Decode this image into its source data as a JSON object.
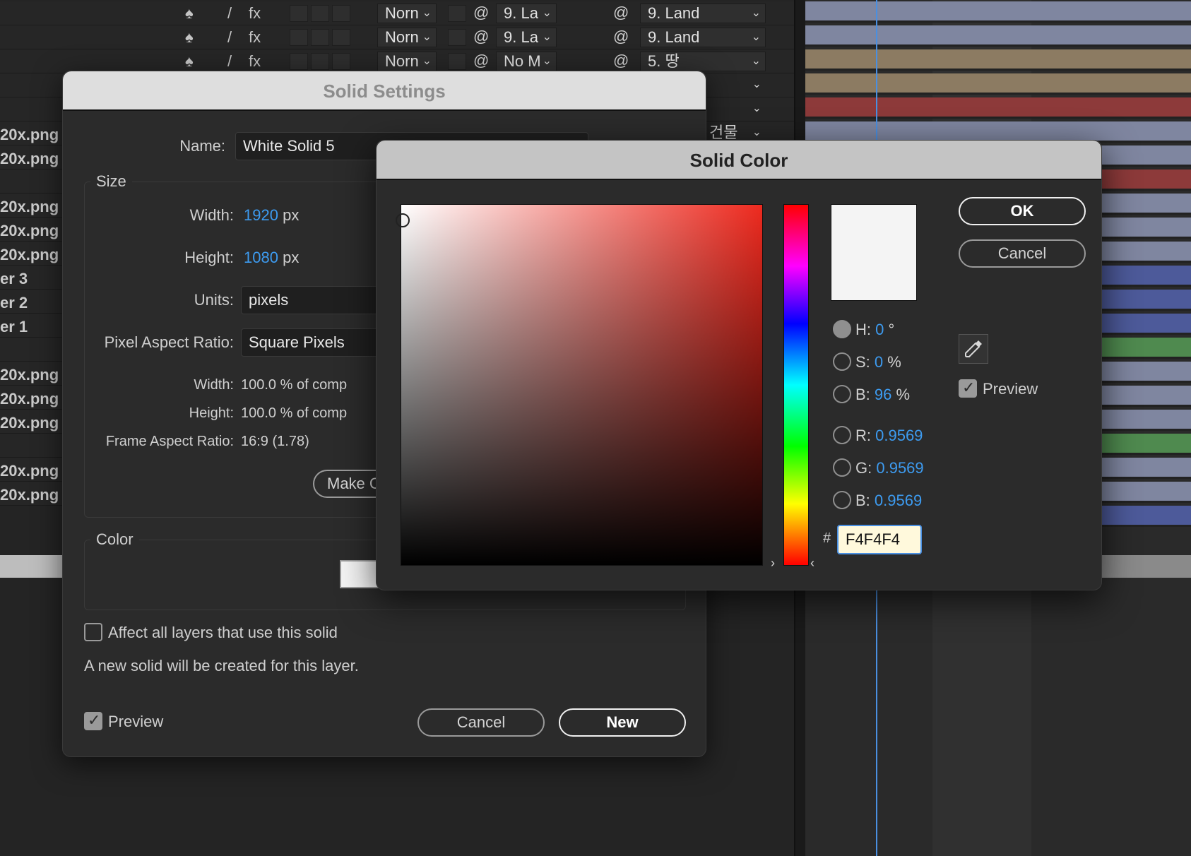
{
  "timeline": {
    "rows": [
      {
        "name": "",
        "mode": "Norn",
        "track_matte_src": "9. La",
        "parent": "9. Land"
      },
      {
        "name": "",
        "mode": "Norn",
        "track_matte_src": "9. La",
        "parent": "9. Land"
      },
      {
        "name": "",
        "mode": "Norn",
        "track_matte_src": "No M",
        "parent": "5. 땅"
      },
      {
        "name": "",
        "mode": "",
        "track_matte_src": "",
        "parent": ""
      },
      {
        "name": "",
        "mode": "",
        "track_matte_src": "",
        "parent": ""
      },
      {
        "name": "20x.png",
        "mode": "",
        "track_matte_src": "",
        "parent": "건물"
      },
      {
        "name": "20x.png",
        "mode": "",
        "track_matte_src": "",
        "parent": ""
      },
      {
        "name": "",
        "mode": "",
        "track_matte_src": "",
        "parent": ""
      },
      {
        "name": "20x.png",
        "mode": "",
        "track_matte_src": "",
        "parent": ""
      },
      {
        "name": "20x.png",
        "mode": "",
        "track_matte_src": "",
        "parent": ""
      },
      {
        "name": "20x.png",
        "mode": "",
        "track_matte_src": "",
        "parent": ""
      },
      {
        "name": "er 3",
        "mode": "",
        "track_matte_src": "",
        "parent": ""
      },
      {
        "name": "er 2",
        "mode": "",
        "track_matte_src": "",
        "parent": ""
      },
      {
        "name": "er 1",
        "mode": "",
        "track_matte_src": "",
        "parent": ""
      },
      {
        "name": "",
        "mode": "",
        "track_matte_src": "",
        "parent": ""
      },
      {
        "name": "20x.png",
        "mode": "",
        "track_matte_src": "",
        "parent": ""
      },
      {
        "name": "20x.png",
        "mode": "",
        "track_matte_src": "",
        "parent": ""
      },
      {
        "name": "20x.png",
        "mode": "",
        "track_matte_src": "",
        "parent": ""
      },
      {
        "name": "",
        "mode": "",
        "track_matte_src": "",
        "parent": ""
      },
      {
        "name": "20x.png",
        "mode": "",
        "track_matte_src": "",
        "parent": ""
      },
      {
        "name": "20x.png",
        "mode": "",
        "track_matte_src": "",
        "parent": ""
      }
    ],
    "bar_colors": [
      "#7f86a0",
      "#7f86a0",
      "#8c7b62",
      "#8c7b62",
      "#8d3a3a",
      "#7f86a0",
      "#7f86a0",
      "#8d3a3a",
      "#7f86a0",
      "#7f86a0",
      "#7f86a0",
      "#4d5a9a",
      "#4d5a9a",
      "#4d5a9a",
      "#4f8a4f",
      "#7f86a0",
      "#7f86a0",
      "#7f86a0",
      "#4f8a4f",
      "#7f86a0",
      "#7f86a0",
      "#4d5a9a"
    ]
  },
  "solid_settings": {
    "title": "Solid Settings",
    "name_label": "Name:",
    "name_value": "White Solid 5",
    "size_group": "Size",
    "width_label": "Width:",
    "width_value": "1920",
    "height_label": "Height:",
    "height_value": "1080",
    "px_unit": "px",
    "units_label": "Units:",
    "units_value": "pixels",
    "par_label": "Pixel Aspect Ratio:",
    "par_value": "Square Pixels",
    "pct_width_label": "Width:",
    "pct_width_value": "100.0 % of comp",
    "pct_height_label": "Height:",
    "pct_height_value": "100.0 % of comp",
    "far_label": "Frame Aspect Ratio:",
    "far_value": "16:9 (1.78)",
    "make_comp_size": "Make Comp Size",
    "color_group": "Color",
    "affect_label": "Affect all layers that use this solid",
    "info_text": "A new solid will be created for this layer.",
    "preview_label": "Preview",
    "cancel_label": "Cancel",
    "new_label": "New",
    "swatch_color": "#F4F4F4"
  },
  "solid_color": {
    "title": "Solid Color",
    "ok_label": "OK",
    "cancel_label": "Cancel",
    "preview_label": "Preview",
    "h_label": "H:",
    "h_value": "0",
    "h_unit": "°",
    "s_label": "S:",
    "s_value": "0",
    "s_unit": "%",
    "b_label": "B:",
    "b_value": "96",
    "b_unit": "%",
    "r_label": "R:",
    "r_value": "0.9569",
    "g_label": "G:",
    "g_value": "0.9569",
    "bl_label": "B:",
    "bl_value": "0.9569",
    "hash_label": "#",
    "hex_value": "F4F4F4",
    "icons": {
      "eyedropper": "eyedropper-icon"
    }
  }
}
